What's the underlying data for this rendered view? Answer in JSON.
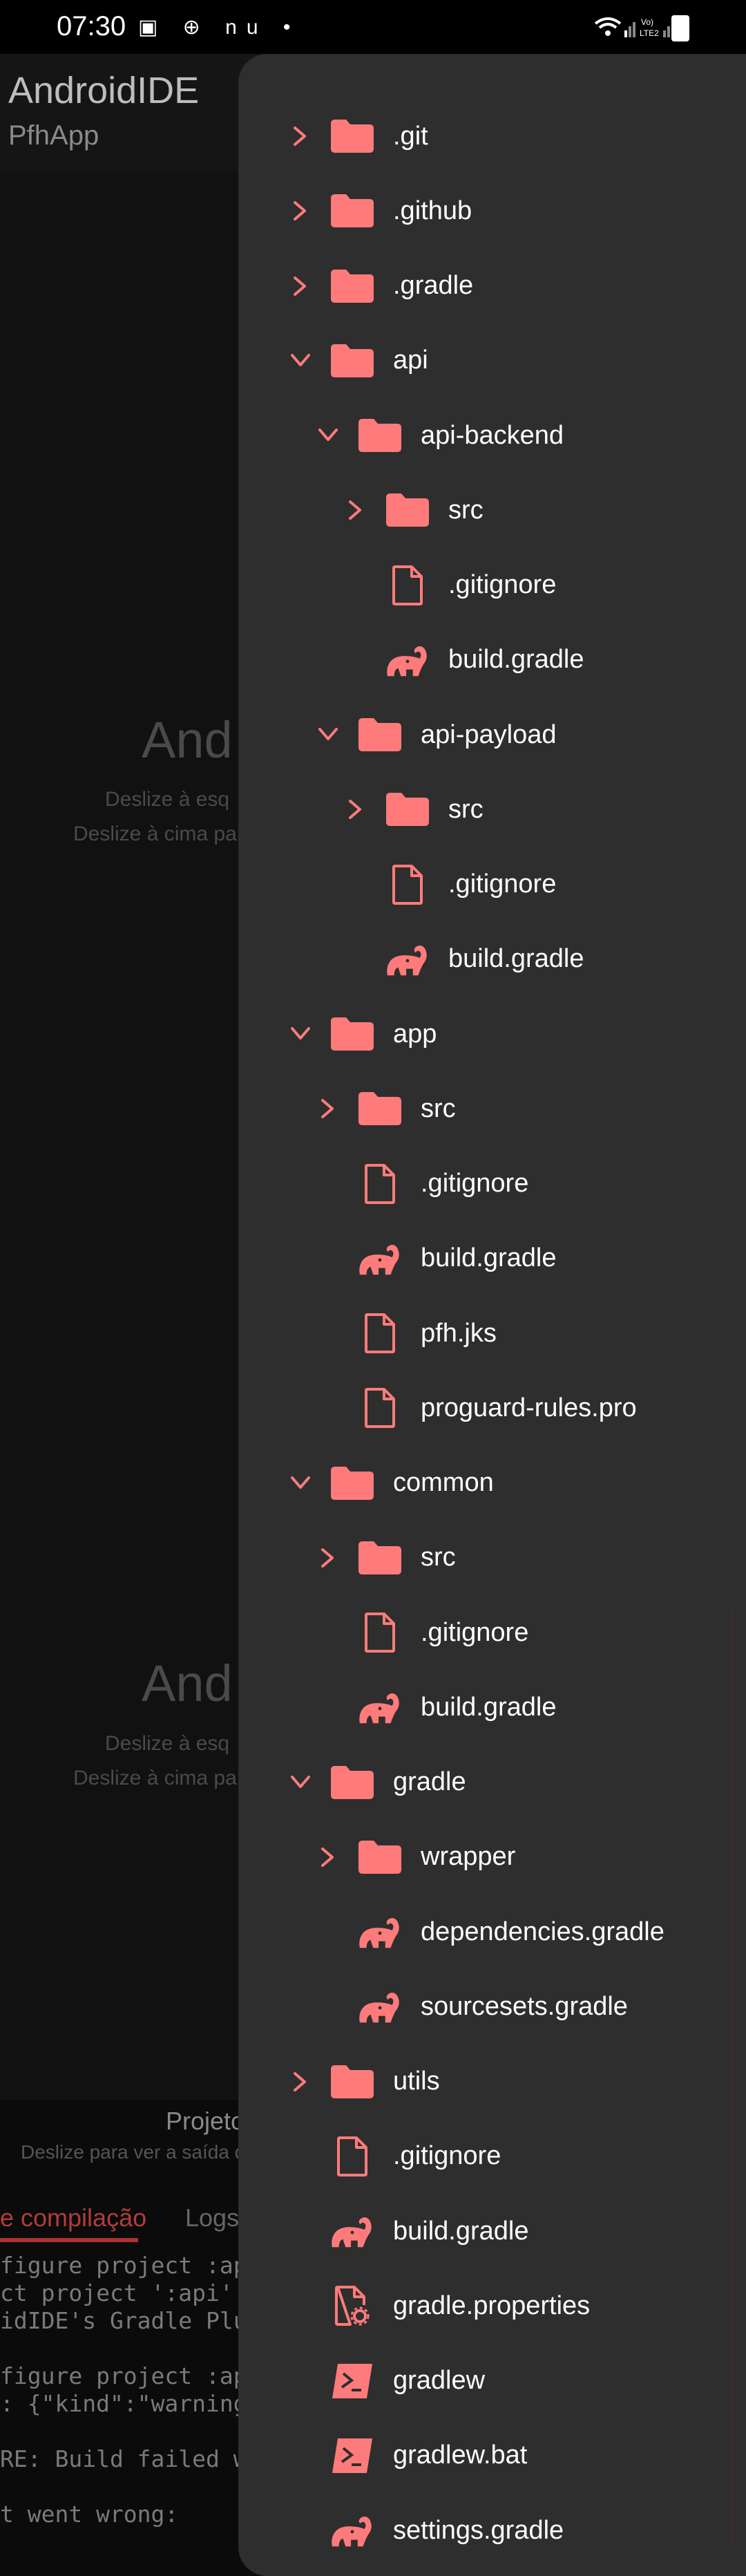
{
  "status_bar": {
    "time": "07:30",
    "left_icons": "▣ ⊕ nu •",
    "right_icons": "Vo) LTE2"
  },
  "background_app": {
    "title": "AndroidIDE",
    "subtitle": "PfhApp",
    "empty_title_1": "And",
    "empty_hint_1a": "Deslize à esq",
    "empty_hint_1b": "Deslize à cima pa",
    "empty_title_2": "And",
    "empty_hint_2a": "Deslize à esq",
    "empty_hint_2b": "Deslize à cima pa",
    "bottom_title": "Projeto",
    "bottom_hint": "Deslize para ver a saída d",
    "tab_active": "e compilação",
    "tab_inactive": "Logs",
    "log_lines": [
      "figure project :api",
      "ct project ':api' c",
      "idIDE's Gradle Plug",
      "",
      "figure project :app",
      ": {\"kind\":\"warning\"",
      "",
      "RE: Build failed wi",
      "",
      "t went wrong:"
    ]
  },
  "file_tree": {
    "accent_color": "#ff7b7b",
    "items": [
      {
        "label": ".git",
        "depth": 0,
        "type": "folder",
        "chevron": "right",
        "icon": "folder-icon"
      },
      {
        "label": ".github",
        "depth": 0,
        "type": "folder",
        "chevron": "right",
        "icon": "folder-icon"
      },
      {
        "label": ".gradle",
        "depth": 0,
        "type": "folder",
        "chevron": "right",
        "icon": "folder-icon"
      },
      {
        "label": "api",
        "depth": 0,
        "type": "folder",
        "chevron": "down",
        "icon": "folder-icon"
      },
      {
        "label": "api-backend",
        "depth": 1,
        "type": "folder",
        "chevron": "down",
        "icon": "folder-icon"
      },
      {
        "label": "src",
        "depth": 2,
        "type": "folder",
        "chevron": "right",
        "icon": "folder-icon"
      },
      {
        "label": ".gitignore",
        "depth": 2,
        "type": "file",
        "chevron": "",
        "icon": "file-icon"
      },
      {
        "label": "build.gradle",
        "depth": 2,
        "type": "gradle",
        "chevron": "",
        "icon": "gradle-elephant-icon"
      },
      {
        "label": "api-payload",
        "depth": 1,
        "type": "folder",
        "chevron": "down",
        "icon": "folder-icon"
      },
      {
        "label": "src",
        "depth": 2,
        "type": "folder",
        "chevron": "right",
        "icon": "folder-icon"
      },
      {
        "label": ".gitignore",
        "depth": 2,
        "type": "file",
        "chevron": "",
        "icon": "file-icon"
      },
      {
        "label": "build.gradle",
        "depth": 2,
        "type": "gradle",
        "chevron": "",
        "icon": "gradle-elephant-icon"
      },
      {
        "label": "app",
        "depth": 0,
        "type": "folder",
        "chevron": "down",
        "icon": "folder-icon"
      },
      {
        "label": "src",
        "depth": 1,
        "type": "folder",
        "chevron": "right",
        "icon": "folder-icon"
      },
      {
        "label": ".gitignore",
        "depth": 1,
        "type": "file",
        "chevron": "",
        "icon": "file-icon"
      },
      {
        "label": "build.gradle",
        "depth": 1,
        "type": "gradle",
        "chevron": "",
        "icon": "gradle-elephant-icon"
      },
      {
        "label": "pfh.jks",
        "depth": 1,
        "type": "file",
        "chevron": "",
        "icon": "file-icon"
      },
      {
        "label": "proguard-rules.pro",
        "depth": 1,
        "type": "file",
        "chevron": "",
        "icon": "file-icon"
      },
      {
        "label": "common",
        "depth": 0,
        "type": "folder",
        "chevron": "down",
        "icon": "folder-icon"
      },
      {
        "label": "src",
        "depth": 1,
        "type": "folder",
        "chevron": "right",
        "icon": "folder-icon"
      },
      {
        "label": ".gitignore",
        "depth": 1,
        "type": "file",
        "chevron": "",
        "icon": "file-icon"
      },
      {
        "label": "build.gradle",
        "depth": 1,
        "type": "gradle",
        "chevron": "",
        "icon": "gradle-elephant-icon"
      },
      {
        "label": "gradle",
        "depth": 0,
        "type": "folder",
        "chevron": "down",
        "icon": "folder-icon"
      },
      {
        "label": "wrapper",
        "depth": 1,
        "type": "folder",
        "chevron": "right",
        "icon": "folder-icon"
      },
      {
        "label": "dependencies.gradle",
        "depth": 1,
        "type": "gradle",
        "chevron": "",
        "icon": "gradle-elephant-icon"
      },
      {
        "label": "sourcesets.gradle",
        "depth": 1,
        "type": "gradle",
        "chevron": "",
        "icon": "gradle-elephant-icon"
      },
      {
        "label": "utils",
        "depth": 0,
        "type": "folder",
        "chevron": "right",
        "icon": "folder-icon"
      },
      {
        "label": ".gitignore",
        "depth": 0,
        "type": "file",
        "chevron": "",
        "icon": "file-icon"
      },
      {
        "label": "build.gradle",
        "depth": 0,
        "type": "gradle",
        "chevron": "",
        "icon": "gradle-elephant-icon"
      },
      {
        "label": "gradle.properties",
        "depth": 0,
        "type": "properties",
        "chevron": "",
        "icon": "settings-file-icon"
      },
      {
        "label": "gradlew",
        "depth": 0,
        "type": "script",
        "chevron": "",
        "icon": "terminal-icon"
      },
      {
        "label": "gradlew.bat",
        "depth": 0,
        "type": "script",
        "chevron": "",
        "icon": "terminal-icon"
      },
      {
        "label": "settings.gradle",
        "depth": 0,
        "type": "gradle",
        "chevron": "",
        "icon": "gradle-elephant-icon"
      }
    ]
  }
}
